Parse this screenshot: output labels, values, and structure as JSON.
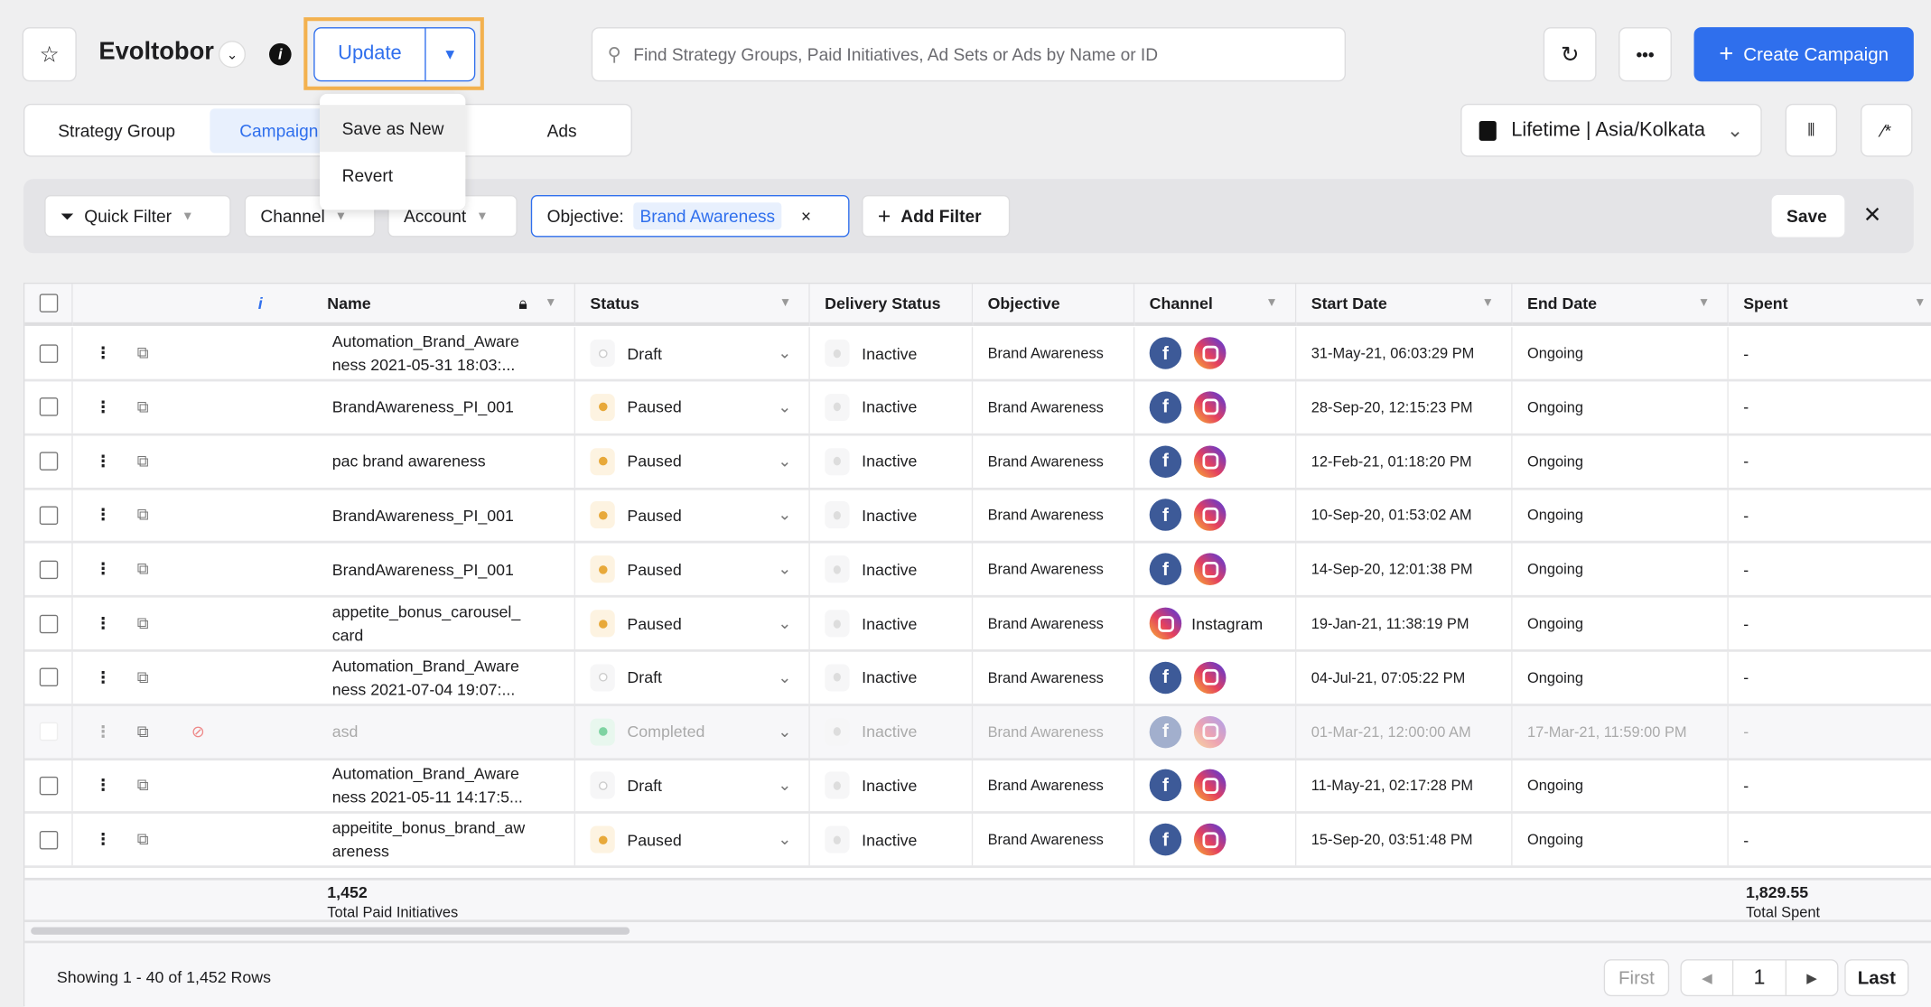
{
  "header": {
    "title": "Evoltobor",
    "update_label": "Update",
    "menu": [
      "Save as New",
      "Revert"
    ],
    "search_placeholder": "Find Strategy Groups, Paid Initiatives, Ad Sets or Ads by Name or ID",
    "create_label": "Create Campaign",
    "primary_color": "#2f6fed",
    "highlight_color": "#f3b14f"
  },
  "tabs": [
    {
      "label": "Strategy Group",
      "active": false
    },
    {
      "label": "Campaign",
      "active": true
    },
    {
      "label": "Ads",
      "active": false
    }
  ],
  "date_picker": "Lifetime | Asia/Kolkata",
  "filters": {
    "quick": "Quick Filter",
    "channel": "Channel",
    "account": "Account",
    "objective_label": "Objective:",
    "objective_value": "Brand Awareness",
    "add": "Add Filter",
    "save": "Save"
  },
  "columns": [
    "Name",
    "Status",
    "Delivery Status",
    "Objective",
    "Channel",
    "Start Date",
    "End Date",
    "Spent"
  ],
  "rows": [
    {
      "name": "Automation_Brand_Aware ness 2021-05-31 18:03:...",
      "status": "Draft",
      "delivery": "Inactive",
      "objective": "Brand Awareness",
      "channels": [
        "facebook",
        "instagram"
      ],
      "start": "31-May-21, 06:03:29 PM",
      "end": "Ongoing",
      "spent": "-"
    },
    {
      "name": "BrandAwareness_PI_001",
      "status": "Paused",
      "delivery": "Inactive",
      "objective": "Brand Awareness",
      "channels": [
        "facebook",
        "instagram"
      ],
      "start": "28-Sep-20, 12:15:23 PM",
      "end": "Ongoing",
      "spent": "-"
    },
    {
      "name": "pac brand awareness",
      "status": "Paused",
      "delivery": "Inactive",
      "objective": "Brand Awareness",
      "channels": [
        "facebook",
        "instagram"
      ],
      "start": "12-Feb-21, 01:18:20 PM",
      "end": "Ongoing",
      "spent": "-"
    },
    {
      "name": "BrandAwareness_PI_001",
      "status": "Paused",
      "delivery": "Inactive",
      "objective": "Brand Awareness",
      "channels": [
        "facebook",
        "instagram"
      ],
      "start": "10-Sep-20, 01:53:02 AM",
      "end": "Ongoing",
      "spent": "-"
    },
    {
      "name": "BrandAwareness_PI_001",
      "status": "Paused",
      "delivery": "Inactive",
      "objective": "Brand Awareness",
      "channels": [
        "facebook",
        "instagram"
      ],
      "start": "14-Sep-20, 12:01:38 PM",
      "end": "Ongoing",
      "spent": "-"
    },
    {
      "name": "appetite_bonus_carousel_ card",
      "status": "Paused",
      "delivery": "Inactive",
      "objective": "Brand Awareness",
      "channels": [
        "instagram"
      ],
      "channel_label": "Instagram",
      "start": "19-Jan-21, 11:38:19 PM",
      "end": "Ongoing",
      "spent": "-"
    },
    {
      "name": "Automation_Brand_Aware ness 2021-07-04 19:07:...",
      "status": "Draft",
      "delivery": "Inactive",
      "objective": "Brand Awareness",
      "channels": [
        "facebook",
        "instagram"
      ],
      "start": "04-Jul-21, 07:05:22 PM",
      "end": "Ongoing",
      "spent": "-"
    },
    {
      "name": "asd",
      "status": "Completed",
      "delivery": "Inactive",
      "objective": "Brand Awareness",
      "channels": [
        "facebook",
        "instagram"
      ],
      "start": "01-Mar-21, 12:00:00 AM",
      "end": "17-Mar-21, 11:59:00 PM",
      "spent": "-",
      "disabled": true
    },
    {
      "name": "Automation_Brand_Aware ness 2021-05-11 14:17:5...",
      "status": "Draft",
      "delivery": "Inactive",
      "objective": "Brand Awareness",
      "channels": [
        "facebook",
        "instagram"
      ],
      "start": "11-May-21, 02:17:28 PM",
      "end": "Ongoing",
      "spent": "-"
    },
    {
      "name": "appeitite_bonus_brand_aw areness",
      "status": "Paused",
      "delivery": "Inactive",
      "objective": "Brand Awareness",
      "channels": [
        "facebook",
        "instagram"
      ],
      "start": "15-Sep-20, 03:51:48 PM",
      "end": "Ongoing",
      "spent": "-"
    }
  ],
  "status_colors": {
    "Draft": "#dddddd",
    "Paused": "#e8a93a",
    "Completed": "#7fd3a2"
  },
  "totals": {
    "count": "1,452",
    "count_label": "Total Paid Initiatives",
    "spent": "1,829.55",
    "spent_label": "Total Spent"
  },
  "pagination": {
    "showing": "Showing 1 - 40 of 1,452 Rows",
    "first": "First",
    "page": "1",
    "last": "Last"
  }
}
